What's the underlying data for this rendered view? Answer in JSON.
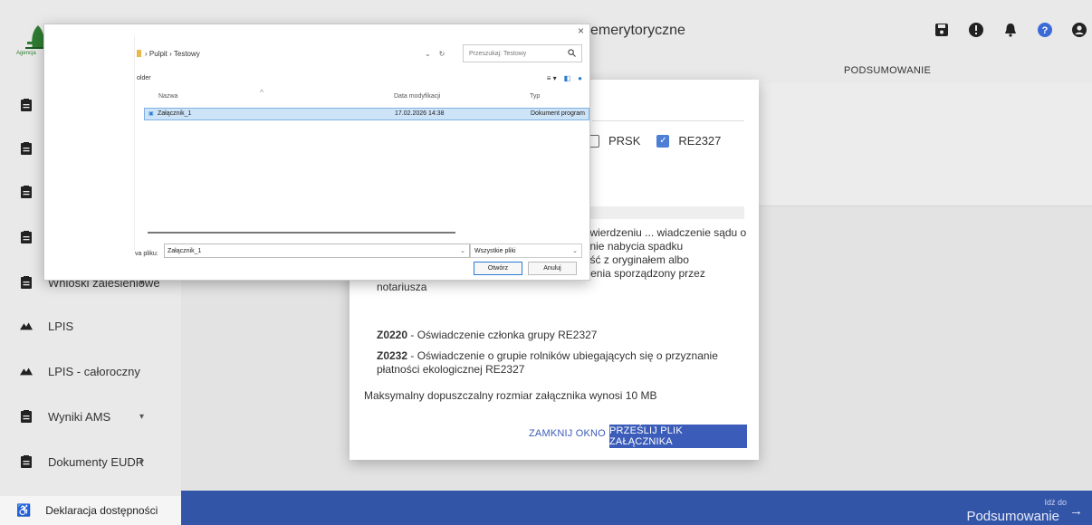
{
  "sidebar": {
    "logo_text": "Agencja",
    "items": [
      {
        "label": "",
        "icon": "clipboard-icon"
      },
      {
        "label": "",
        "icon": "clipboard-icon"
      },
      {
        "label": "",
        "icon": "clipboard-icon"
      },
      {
        "label": "",
        "icon": "clipboard-icon"
      },
      {
        "label": "Wnioski zalesieniowe",
        "icon": "clipboard-icon"
      },
      {
        "label": "LPIS",
        "icon": "map-icon"
      },
      {
        "label": "LPIS - całoroczny",
        "icon": "map-icon"
      },
      {
        "label": "Wyniki AMS",
        "icon": "clipboard-icon"
      },
      {
        "label": "Dokumenty EUDR",
        "icon": "clipboard-icon"
      }
    ],
    "accessibility_label": "Deklaracja dostępności"
  },
  "header": {
    "title": "emerytoryczne",
    "tab_summary": "PODSUMOWANIE",
    "icons": [
      "save-icon",
      "alert-icon",
      "bell-icon",
      "help-icon",
      "user-icon"
    ]
  },
  "bottombar": {
    "goto_small": "Idź do",
    "goto_big": "Podsumowanie",
    "arrow": "→"
  },
  "modal": {
    "checkboxes": [
      {
        "label": "PRSK",
        "checked": false
      },
      {
        "label": "RE2327",
        "checked": true
      }
    ],
    "description": "sądu o stwierdzeniu nabycia ... nia sądu o stwierdzeniu ... wiadczenie sądu o ... ia spadku albo Kopia wniosku o stwierdzenie nabycia spadku potwierdzona albo poświadczona za zgodność z oryginałem albo Zarejestrowany akt poświadczenia dziedziczenia sporządzony przez notariusza",
    "attachments": [
      {
        "code": "Z0220",
        "text": " - Oświadczenie członka grupy RE2327"
      },
      {
        "code": "Z0232",
        "text": " - Oświadczenie o grupie rolników ubiegających się o przyznanie płatności ekologicznej RE2327"
      }
    ],
    "max_size": "Maksymalny dopuszczalny rozmiar załącznika wynosi 10 MB",
    "close_label": "ZAMKNIJ OKNO",
    "send_label": "PRZEŚLIJ PLIK ZAŁĄCZNIKA"
  },
  "file_dialog": {
    "close": "×",
    "breadcrumb": "›  Pulpit  ›  Testowy",
    "search_placeholder": "Przeszukaj: Testowy",
    "toolbar_left": "older",
    "columns": {
      "name": "Nazwa",
      "date": "Data modyfikacji",
      "type": "Typ"
    },
    "files": [
      {
        "name": "Załącznik_1",
        "date": "17.02.2026 14:38",
        "type": "Dokument program"
      }
    ],
    "filename_label": "va pliku:",
    "filename_value": "Załącznik_1",
    "filetype": "Wszystkie pliki",
    "open_label": "Otwórz",
    "cancel_label": "Anuluj"
  },
  "colors": {
    "accent": "#3b5cb8",
    "bottombar": "#3355a8",
    "selection": "#cde3f8",
    "checkbox": "#4d7fd6"
  }
}
